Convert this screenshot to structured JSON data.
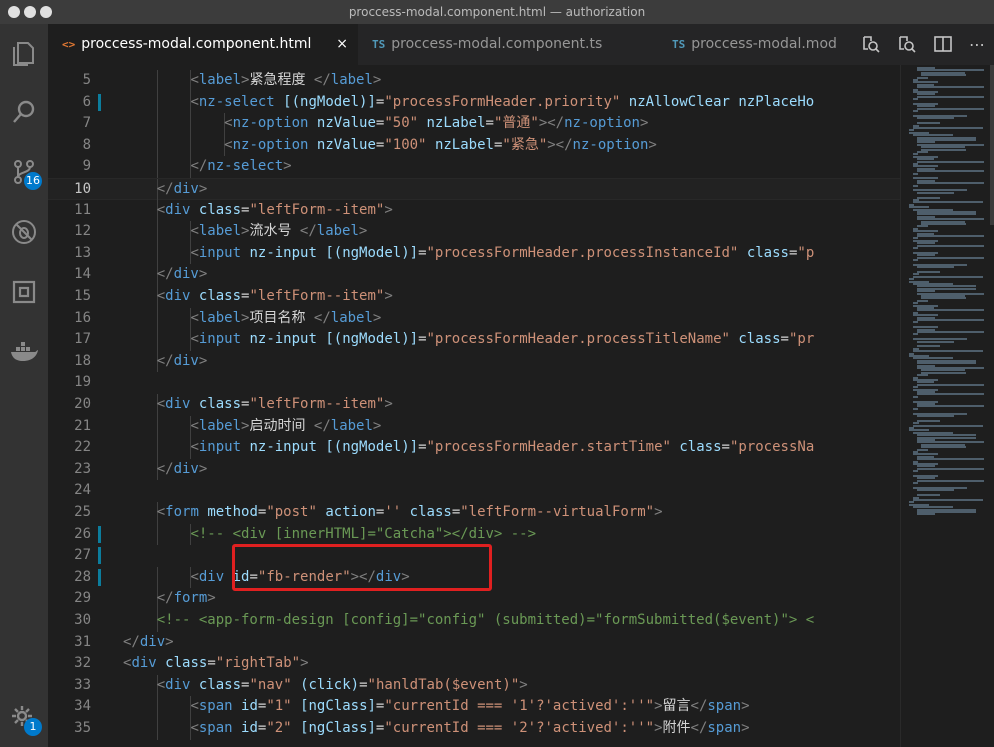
{
  "window": {
    "title": "proccess-modal.component.html — authorization"
  },
  "activity_bar": {
    "items": [
      {
        "name": "explorer-icon"
      },
      {
        "name": "search-icon"
      },
      {
        "name": "source-control-icon",
        "badge": "16"
      },
      {
        "name": "debug-icon"
      },
      {
        "name": "extensions-icon"
      },
      {
        "name": "docker-icon"
      }
    ],
    "settings_badge": "1"
  },
  "tabs": [
    {
      "type": "<>",
      "label": "proccess-modal.component.html",
      "active": true,
      "close": "×"
    },
    {
      "type": "TS",
      "label": "proccess-modal.component.ts",
      "active": false
    },
    {
      "type": "TS",
      "label": "proccess-modal.mod",
      "active": false
    }
  ],
  "editor": {
    "lines": [
      {
        "n": "5",
        "indent": 2,
        "tokens": [
          [
            "punct",
            "<"
          ],
          [
            "tag",
            "label"
          ],
          [
            "punct",
            ">"
          ],
          [
            "txt",
            "紧急程度 "
          ],
          [
            "punct",
            "</"
          ],
          [
            "tag",
            "label"
          ],
          [
            "punct",
            ">"
          ]
        ]
      },
      {
        "n": "6",
        "indent": 2,
        "modified": true,
        "tokens": [
          [
            "punct",
            "<"
          ],
          [
            "tag",
            "nz-select"
          ],
          [
            "txt",
            " "
          ],
          [
            "attr",
            "[(ngModel)]"
          ],
          [
            "txt",
            "="
          ],
          [
            "str",
            "\"processFormHeader.priority\""
          ],
          [
            "txt",
            " "
          ],
          [
            "attr",
            "nzAllowClear"
          ],
          [
            "txt",
            " "
          ],
          [
            "attr",
            "nzPlaceHo"
          ]
        ]
      },
      {
        "n": "7",
        "indent": 3,
        "tokens": [
          [
            "punct",
            "<"
          ],
          [
            "tag",
            "nz-option"
          ],
          [
            "txt",
            " "
          ],
          [
            "attr",
            "nzValue"
          ],
          [
            "txt",
            "="
          ],
          [
            "str",
            "\"50\""
          ],
          [
            "txt",
            " "
          ],
          [
            "attr",
            "nzLabel"
          ],
          [
            "txt",
            "="
          ],
          [
            "str",
            "\"普通\""
          ],
          [
            "punct",
            "></"
          ],
          [
            "tag",
            "nz-option"
          ],
          [
            "punct",
            ">"
          ]
        ]
      },
      {
        "n": "8",
        "indent": 3,
        "tokens": [
          [
            "punct",
            "<"
          ],
          [
            "tag",
            "nz-option"
          ],
          [
            "txt",
            " "
          ],
          [
            "attr",
            "nzValue"
          ],
          [
            "txt",
            "="
          ],
          [
            "str",
            "\"100\""
          ],
          [
            "txt",
            " "
          ],
          [
            "attr",
            "nzLabel"
          ],
          [
            "txt",
            "="
          ],
          [
            "str",
            "\"紧急\""
          ],
          [
            "punct",
            "></"
          ],
          [
            "tag",
            "nz-option"
          ],
          [
            "punct",
            ">"
          ]
        ]
      },
      {
        "n": "9",
        "indent": 2,
        "tokens": [
          [
            "punct",
            "</"
          ],
          [
            "tag",
            "nz-select"
          ],
          [
            "punct",
            ">"
          ]
        ]
      },
      {
        "n": "10",
        "indent": 1,
        "current": true,
        "tokens": [
          [
            "punct",
            "</"
          ],
          [
            "tag",
            "div"
          ],
          [
            "punct",
            ">"
          ]
        ]
      },
      {
        "n": "11",
        "indent": 1,
        "tokens": [
          [
            "punct",
            "<"
          ],
          [
            "tag",
            "div"
          ],
          [
            "txt",
            " "
          ],
          [
            "attr",
            "class"
          ],
          [
            "txt",
            "="
          ],
          [
            "str",
            "\"leftForm--item\""
          ],
          [
            "punct",
            ">"
          ]
        ]
      },
      {
        "n": "12",
        "indent": 2,
        "tokens": [
          [
            "punct",
            "<"
          ],
          [
            "tag",
            "label"
          ],
          [
            "punct",
            ">"
          ],
          [
            "txt",
            "流水号 "
          ],
          [
            "punct",
            "</"
          ],
          [
            "tag",
            "label"
          ],
          [
            "punct",
            ">"
          ]
        ]
      },
      {
        "n": "13",
        "indent": 2,
        "tokens": [
          [
            "punct",
            "<"
          ],
          [
            "tag",
            "input"
          ],
          [
            "txt",
            " "
          ],
          [
            "attr",
            "nz-input"
          ],
          [
            "txt",
            " "
          ],
          [
            "attr",
            "[(ngModel)]"
          ],
          [
            "txt",
            "="
          ],
          [
            "str",
            "\"processFormHeader.processInstanceId\""
          ],
          [
            "txt",
            " "
          ],
          [
            "attr",
            "class"
          ],
          [
            "txt",
            "="
          ],
          [
            "str",
            "\"p"
          ]
        ]
      },
      {
        "n": "14",
        "indent": 1,
        "tokens": [
          [
            "punct",
            "</"
          ],
          [
            "tag",
            "div"
          ],
          [
            "punct",
            ">"
          ]
        ]
      },
      {
        "n": "15",
        "indent": 1,
        "tokens": [
          [
            "punct",
            "<"
          ],
          [
            "tag",
            "div"
          ],
          [
            "txt",
            " "
          ],
          [
            "attr",
            "class"
          ],
          [
            "txt",
            "="
          ],
          [
            "str",
            "\"leftForm--item\""
          ],
          [
            "punct",
            ">"
          ]
        ]
      },
      {
        "n": "16",
        "indent": 2,
        "tokens": [
          [
            "punct",
            "<"
          ],
          [
            "tag",
            "label"
          ],
          [
            "punct",
            ">"
          ],
          [
            "txt",
            "项目名称 "
          ],
          [
            "punct",
            "</"
          ],
          [
            "tag",
            "label"
          ],
          [
            "punct",
            ">"
          ]
        ]
      },
      {
        "n": "17",
        "indent": 2,
        "tokens": [
          [
            "punct",
            "<"
          ],
          [
            "tag",
            "input"
          ],
          [
            "txt",
            " "
          ],
          [
            "attr",
            "nz-input"
          ],
          [
            "txt",
            " "
          ],
          [
            "attr",
            "[(ngModel)]"
          ],
          [
            "txt",
            "="
          ],
          [
            "str",
            "\"processFormHeader.processTitleName\""
          ],
          [
            "txt",
            " "
          ],
          [
            "attr",
            "class"
          ],
          [
            "txt",
            "="
          ],
          [
            "str",
            "\"pr"
          ]
        ]
      },
      {
        "n": "18",
        "indent": 1,
        "tokens": [
          [
            "punct",
            "</"
          ],
          [
            "tag",
            "div"
          ],
          [
            "punct",
            ">"
          ]
        ]
      },
      {
        "n": "19",
        "indent": 0,
        "tokens": []
      },
      {
        "n": "20",
        "indent": 1,
        "tokens": [
          [
            "punct",
            "<"
          ],
          [
            "tag",
            "div"
          ],
          [
            "txt",
            " "
          ],
          [
            "attr",
            "class"
          ],
          [
            "txt",
            "="
          ],
          [
            "str",
            "\"leftForm--item\""
          ],
          [
            "punct",
            ">"
          ]
        ]
      },
      {
        "n": "21",
        "indent": 2,
        "tokens": [
          [
            "punct",
            "<"
          ],
          [
            "tag",
            "label"
          ],
          [
            "punct",
            ">"
          ],
          [
            "txt",
            "启动时间 "
          ],
          [
            "punct",
            "</"
          ],
          [
            "tag",
            "label"
          ],
          [
            "punct",
            ">"
          ]
        ]
      },
      {
        "n": "22",
        "indent": 2,
        "tokens": [
          [
            "punct",
            "<"
          ],
          [
            "tag",
            "input"
          ],
          [
            "txt",
            " "
          ],
          [
            "attr",
            "nz-input"
          ],
          [
            "txt",
            " "
          ],
          [
            "attr",
            "[(ngModel)]"
          ],
          [
            "txt",
            "="
          ],
          [
            "str",
            "\"processFormHeader.startTime\""
          ],
          [
            "txt",
            " "
          ],
          [
            "attr",
            "class"
          ],
          [
            "txt",
            "="
          ],
          [
            "str",
            "\"processNa"
          ]
        ]
      },
      {
        "n": "23",
        "indent": 1,
        "tokens": [
          [
            "punct",
            "</"
          ],
          [
            "tag",
            "div"
          ],
          [
            "punct",
            ">"
          ]
        ]
      },
      {
        "n": "24",
        "indent": 0,
        "tokens": []
      },
      {
        "n": "25",
        "indent": 1,
        "tokens": [
          [
            "punct",
            "<"
          ],
          [
            "tag",
            "form"
          ],
          [
            "txt",
            " "
          ],
          [
            "attr",
            "method"
          ],
          [
            "txt",
            "="
          ],
          [
            "str",
            "\"post\""
          ],
          [
            "txt",
            " "
          ],
          [
            "attr",
            "action"
          ],
          [
            "txt",
            "="
          ],
          [
            "str",
            "''"
          ],
          [
            "txt",
            " "
          ],
          [
            "attr",
            "class"
          ],
          [
            "txt",
            "="
          ],
          [
            "str",
            "\"leftForm--virtualForm\""
          ],
          [
            "punct",
            ">"
          ]
        ]
      },
      {
        "n": "26",
        "indent": 2,
        "modified": true,
        "tokens": [
          [
            "cmt",
            "<!-- <div [innerHTML]=\"Catcha\"></div> -->"
          ]
        ]
      },
      {
        "n": "27",
        "indent": 0,
        "modified": true,
        "tokens": []
      },
      {
        "n": "28",
        "indent": 2,
        "modified": true,
        "tokens": [
          [
            "punct",
            "<"
          ],
          [
            "tag",
            "div"
          ],
          [
            "txt",
            " "
          ],
          [
            "attr",
            "id"
          ],
          [
            "txt",
            "="
          ],
          [
            "str",
            "\"fb-render\""
          ],
          [
            "punct",
            "></"
          ],
          [
            "tag",
            "div"
          ],
          [
            "punct",
            ">"
          ]
        ]
      },
      {
        "n": "29",
        "indent": 1,
        "tokens": [
          [
            "punct",
            "</"
          ],
          [
            "tag",
            "form"
          ],
          [
            "punct",
            ">"
          ]
        ]
      },
      {
        "n": "30",
        "indent": 1,
        "tokens": [
          [
            "cmt",
            "<!-- <app-form-design [config]=\"config\" (submitted)=\"formSubmitted($event)\"> <"
          ]
        ]
      },
      {
        "n": "31",
        "indent": 0,
        "tokens": [
          [
            "punct",
            "</"
          ],
          [
            "tag",
            "div"
          ],
          [
            "punct",
            ">"
          ]
        ]
      },
      {
        "n": "32",
        "indent": 0,
        "tokens": [
          [
            "punct",
            "<"
          ],
          [
            "tag",
            "div"
          ],
          [
            "txt",
            " "
          ],
          [
            "attr",
            "class"
          ],
          [
            "txt",
            "="
          ],
          [
            "str",
            "\"rightTab\""
          ],
          [
            "punct",
            ">"
          ]
        ]
      },
      {
        "n": "33",
        "indent": 1,
        "tokens": [
          [
            "punct",
            "<"
          ],
          [
            "tag",
            "div"
          ],
          [
            "txt",
            " "
          ],
          [
            "attr",
            "class"
          ],
          [
            "txt",
            "="
          ],
          [
            "str",
            "\"nav\""
          ],
          [
            "txt",
            " "
          ],
          [
            "attr",
            "(click)"
          ],
          [
            "txt",
            "="
          ],
          [
            "str",
            "\"hanldTab($event)\""
          ],
          [
            "punct",
            ">"
          ]
        ]
      },
      {
        "n": "34",
        "indent": 2,
        "tokens": [
          [
            "punct",
            "<"
          ],
          [
            "tag",
            "span"
          ],
          [
            "txt",
            " "
          ],
          [
            "attr",
            "id"
          ],
          [
            "txt",
            "="
          ],
          [
            "str",
            "\"1\""
          ],
          [
            "txt",
            " "
          ],
          [
            "attr",
            "[ngClass]"
          ],
          [
            "txt",
            "="
          ],
          [
            "str",
            "\"currentId === '1'?'actived':''\""
          ],
          [
            "punct",
            ">"
          ],
          [
            "txt",
            "留言"
          ],
          [
            "punct",
            "</"
          ],
          [
            "tag",
            "span"
          ],
          [
            "punct",
            ">"
          ]
        ]
      },
      {
        "n": "35",
        "indent": 2,
        "tokens": [
          [
            "punct",
            "<"
          ],
          [
            "tag",
            "span"
          ],
          [
            "txt",
            " "
          ],
          [
            "attr",
            "id"
          ],
          [
            "txt",
            "="
          ],
          [
            "str",
            "\"2\""
          ],
          [
            "txt",
            " "
          ],
          [
            "attr",
            "[ngClass]"
          ],
          [
            "txt",
            "="
          ],
          [
            "str",
            "\"currentId === '2'?'actived':''\""
          ],
          [
            "punct",
            ">"
          ],
          [
            "txt",
            "附件"
          ],
          [
            "punct",
            "</"
          ],
          [
            "tag",
            "span"
          ],
          [
            "punct",
            ">"
          ]
        ]
      }
    ]
  }
}
